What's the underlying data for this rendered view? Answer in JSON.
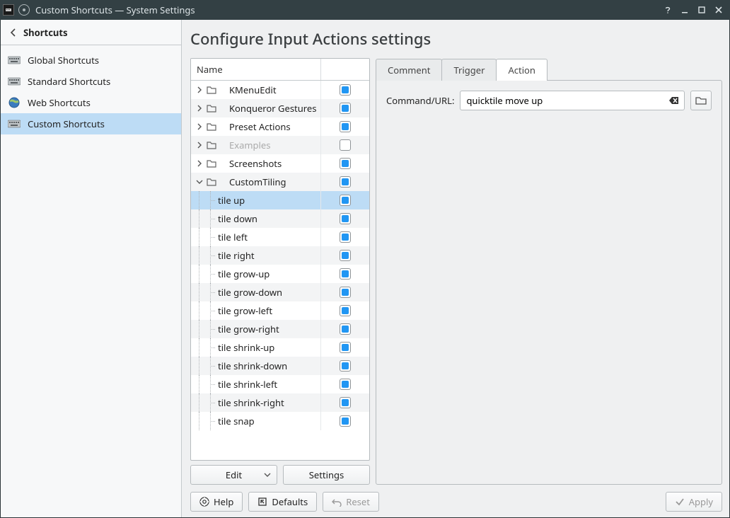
{
  "window": {
    "title": "Custom Shortcuts — System Settings"
  },
  "sidebar": {
    "header": "Shortcuts",
    "items": [
      {
        "label": "Global Shortcuts",
        "icon": "keyboard"
      },
      {
        "label": "Standard Shortcuts",
        "icon": "keyboard"
      },
      {
        "label": "Web Shortcuts",
        "icon": "globe"
      },
      {
        "label": "Custom Shortcuts",
        "icon": "keyboard",
        "active": true
      }
    ]
  },
  "page": {
    "title": "Configure Input Actions settings"
  },
  "tree": {
    "column_name": "Name",
    "groups": [
      {
        "label": "KMenuEdit",
        "expanded": false,
        "checked": true
      },
      {
        "label": "Konqueror Gestures",
        "expanded": false,
        "checked": true
      },
      {
        "label": "Preset Actions",
        "expanded": false,
        "checked": true
      },
      {
        "label": "Examples",
        "expanded": false,
        "checked": false,
        "disabled": true
      },
      {
        "label": "Screenshots",
        "expanded": false,
        "checked": true
      },
      {
        "label": "CustomTiling",
        "expanded": true,
        "checked": true,
        "children": [
          {
            "label": "tile up",
            "checked": true,
            "selected": true
          },
          {
            "label": "tile down",
            "checked": true
          },
          {
            "label": "tile left",
            "checked": true
          },
          {
            "label": "tile right",
            "checked": true
          },
          {
            "label": "tile grow-up",
            "checked": true
          },
          {
            "label": "tile grow-down",
            "checked": true
          },
          {
            "label": "tile grow-left",
            "checked": true
          },
          {
            "label": "tile grow-right",
            "checked": true
          },
          {
            "label": "tile shrink-up",
            "checked": true
          },
          {
            "label": "tile shrink-down",
            "checked": true
          },
          {
            "label": "tile shrink-left",
            "checked": true
          },
          {
            "label": "tile shrink-right",
            "checked": true
          },
          {
            "label": "tile snap",
            "checked": true
          }
        ]
      }
    ],
    "edit_button": "Edit",
    "settings_button": "Settings"
  },
  "tabs": {
    "items": [
      {
        "label": "Comment"
      },
      {
        "label": "Trigger"
      },
      {
        "label": "Action",
        "active": true
      }
    ]
  },
  "action_tab": {
    "field_label": "Command/URL:",
    "value": "quicktile move up"
  },
  "bottom": {
    "help": "Help",
    "defaults": "Defaults",
    "reset": "Reset",
    "apply": "Apply"
  }
}
